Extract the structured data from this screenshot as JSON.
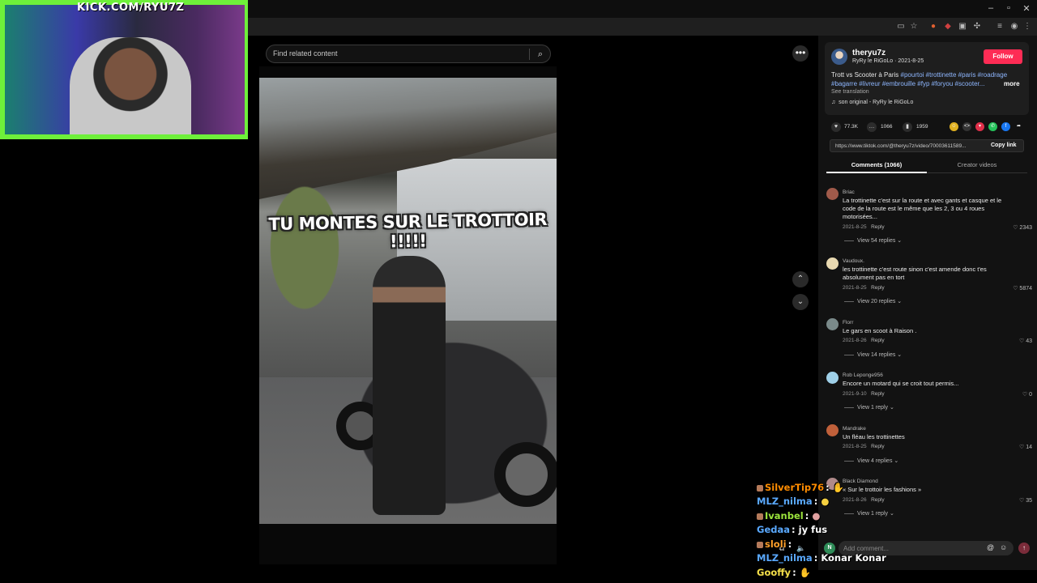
{
  "webcam": {
    "title": "KICK.COM/RYU7Z"
  },
  "search": {
    "placeholder": "Find related content"
  },
  "video": {
    "overlay_text": "TU MONTES SUR LE TROTTOIR !!!!!"
  },
  "author": {
    "username": "theryu7z",
    "display_line": "RyRy le RiGoLo · 2021-8-25",
    "follow_label": "Follow",
    "caption_plain": "Trott vs Scooter à Paris ",
    "caption_tags_1": "#pourtoi #trottinette #paris #roadrage",
    "caption_tags_2": "#bagarre #livreur #embrouille #fyp #foryou #scooter...",
    "more_label": "more",
    "see_translation": "See translation",
    "sound": "son original - RyRy le RiGoLo"
  },
  "stats": {
    "likes": "77.3K",
    "comments": "1066",
    "saves": "1959"
  },
  "link": {
    "url": "https://www.tiktok.com/@theryu7z/video/70003611589...",
    "copy_label": "Copy link"
  },
  "tabs": {
    "comments": "Comments (1066)",
    "creator": "Creator videos"
  },
  "comments": [
    {
      "user": "Briac",
      "text": "La trottinette c'est sur la route et avec gants et casque et le code de la route est le même que les 2, 3 ou 4 roues motorisées...",
      "date": "2021-8-25",
      "reply": "Reply",
      "likes": "2343",
      "view": "View 54 replies",
      "avatar_color": "#a05a4a"
    },
    {
      "user": "Vaudoux.",
      "text": "les trottinette c'est route sinon c'est amende donc t'es absolument pas en tort",
      "date": "2021-8-25",
      "reply": "Reply",
      "likes": "5874",
      "view": "View 20 replies",
      "avatar_color": "#e8d8b0"
    },
    {
      "user": "Florr",
      "text": "Le gars en scoot à Raison .",
      "date": "2021-8-26",
      "reply": "Reply",
      "likes": "43",
      "view": "View 14 replies",
      "avatar_color": "#7a8a8a"
    },
    {
      "user": "Rob Leponge956",
      "text": "Encore un motard qui se croit tout permis...",
      "date": "2021-9-10",
      "reply": "Reply",
      "likes": "0",
      "view": "View 1 reply",
      "avatar_color": "#9fd0e8"
    },
    {
      "user": "Mandrake",
      "text": "Un fléau les trottinettes",
      "date": "2021-8-25",
      "reply": "Reply",
      "likes": "14",
      "view": "View 4 replies",
      "avatar_color": "#c0603a"
    },
    {
      "user": "Black Diamond",
      "text": "« Sur le trottoir les fashions »",
      "date": "2021-8-26",
      "reply": "Reply",
      "likes": "35",
      "view": "View 1 reply",
      "avatar_color": "#b08a8a"
    }
  ],
  "comment_box": {
    "placeholder": "Add comment...",
    "avatar_letter": "N"
  },
  "chat": [
    {
      "user": "SilverTip76",
      "sep": ":",
      "msg": "",
      "color": "#ff8c00",
      "badge": true
    },
    {
      "user": "MLZ_nilma",
      "sep": ":",
      "msg": "",
      "color": "#5aa9ff",
      "badge": false
    },
    {
      "user": "Ivanbel",
      "sep": ":",
      "msg": "",
      "color": "#9be33c",
      "badge": true
    },
    {
      "user": "Gedaa",
      "sep": ":",
      "msg": "jy fus",
      "color": "#5aa9ff",
      "badge": false
    },
    {
      "user": "sloli",
      "sep": ":",
      "msg": "",
      "color": "#ff9f2a",
      "badge": true
    },
    {
      "user": "MLZ_nilma",
      "sep": ":",
      "msg": "Konar Konar",
      "color": "#5aa9ff",
      "badge": false
    },
    {
      "user": "Gooffy",
      "sep": ":",
      "msg": "",
      "color": "#f5e04a",
      "badge": false
    }
  ]
}
